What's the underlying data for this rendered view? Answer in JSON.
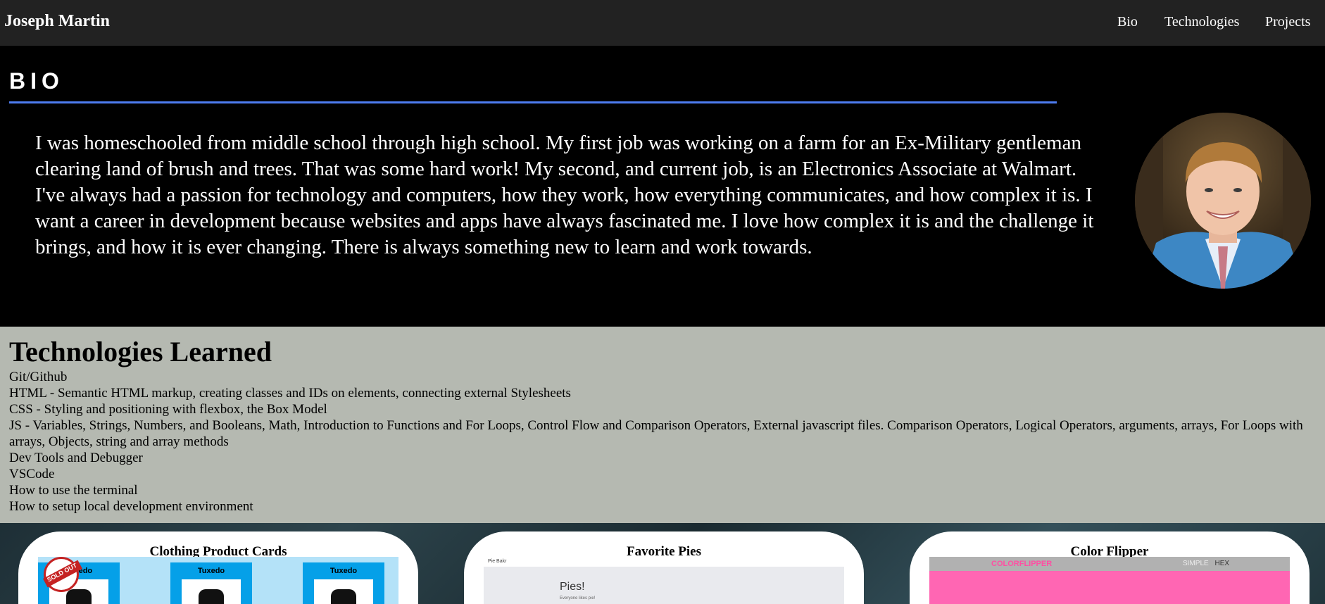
{
  "header": {
    "brand": "Joseph Martin",
    "nav": [
      "Bio",
      "Technologies",
      "Projects"
    ]
  },
  "bio": {
    "title": "BIO",
    "text": "I was homeschooled from middle school through high school. My first job was working on a farm for an Ex-Military gentleman clearing land of brush and trees. That was some hard work! My second, and current job, is an Electronics Associate at Walmart. I've always had a passion for technology and computers, how they work, how everything communicates, and how complex it is. I want a career in development because websites and apps have always fascinated me. I love how complex it is and the challenge it brings, and how it is ever changing. There is always something new to learn and work towards."
  },
  "technologies": {
    "title": "Technologies Learned",
    "items": [
      "Git/Github",
      "HTML - Semantic HTML markup, creating classes and IDs on elements, connecting external Stylesheets",
      "CSS - Styling and positioning with flexbox, the Box Model",
      "JS - Variables, Strings, Numbers, and Booleans, Math, Introduction to Functions and For Loops, Control Flow and Comparison Operators, External javascript files. Comparison Operators, Logical Operators, arguments, arrays, For Loops with arrays, Objects, string and array methods",
      "Dev Tools and Debugger",
      "VSCode",
      "How to use the terminal",
      "How to setup local development environment"
    ]
  },
  "projects": [
    {
      "title": "Clothing Product Cards",
      "thumb": {
        "label": "Tuxedo",
        "badge": "SOLD OUT"
      }
    },
    {
      "title": "Favorite Pies",
      "thumb": {
        "brand": "Pie Bakr",
        "heading": "Pies!",
        "sub": "Everyone likes pie!"
      }
    },
    {
      "title": "Color Flipper",
      "thumb": {
        "logo": "COLORFLIPPER",
        "nav_simple": "SIMPLE",
        "nav_hex": "HEX",
        "color": "#ff66b3"
      }
    }
  ]
}
